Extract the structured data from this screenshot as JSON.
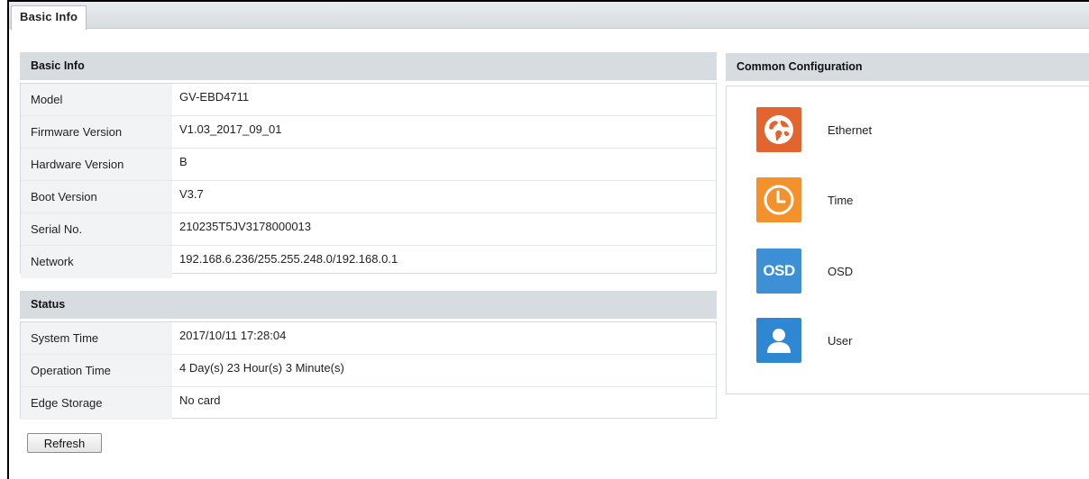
{
  "tab": {
    "label": "Basic Info"
  },
  "basic_info": {
    "title": "Basic Info",
    "rows": [
      {
        "label": "Model",
        "value": "GV-EBD4711"
      },
      {
        "label": "Firmware Version",
        "value": "V1.03_2017_09_01"
      },
      {
        "label": "Hardware Version",
        "value": "B"
      },
      {
        "label": "Boot Version",
        "value": "V3.7"
      },
      {
        "label": "Serial No.",
        "value": "210235T5JV3178000013"
      },
      {
        "label": "Network",
        "value": "192.168.6.236/255.255.248.0/192.168.0.1"
      }
    ]
  },
  "status": {
    "title": "Status",
    "rows": [
      {
        "label": "System Time",
        "value": "2017/10/11 17:28:04"
      },
      {
        "label": "Operation Time",
        "value": "4 Day(s) 23 Hour(s) 3 Minute(s)"
      },
      {
        "label": "Edge Storage",
        "value": "No card"
      }
    ]
  },
  "refresh_label": "Refresh",
  "common_config": {
    "title": "Common Configuration",
    "items": [
      {
        "label": "Ethernet",
        "icon": "ethernet-globe-icon",
        "color": "#e2642e"
      },
      {
        "label": "Time",
        "icon": "clock-icon",
        "color": "#f3922c"
      },
      {
        "label": "OSD",
        "icon": "osd-icon",
        "icon_text": "OSD",
        "color": "#3d8fd6"
      },
      {
        "label": "User",
        "icon": "user-icon",
        "color": "#2f86d1"
      }
    ]
  }
}
